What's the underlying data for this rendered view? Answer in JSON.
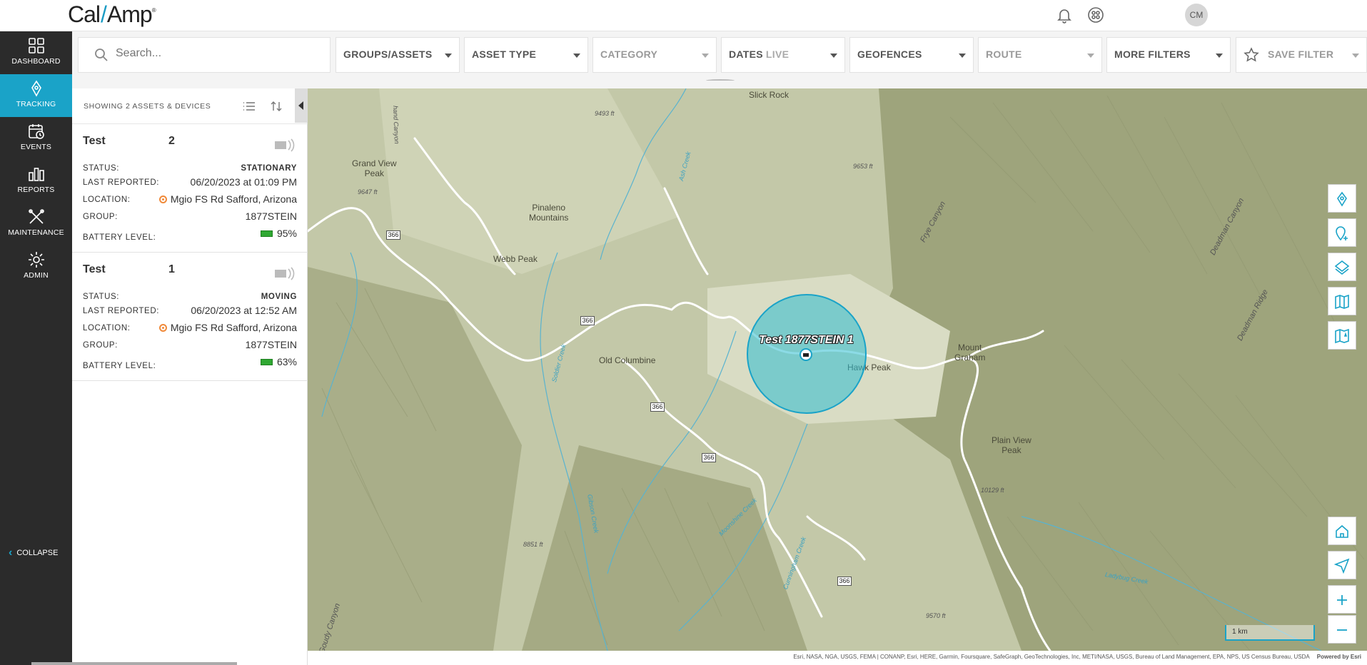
{
  "app": {
    "logo_left": "Cal",
    "logo_right": "Amp",
    "avatar_initials": "CM"
  },
  "nav": {
    "items": [
      {
        "label": "DASHBOARD",
        "icon": "dashboard-icon"
      },
      {
        "label": "TRACKING",
        "icon": "location-pin-icon",
        "active": true
      },
      {
        "label": "EVENTS",
        "icon": "calendar-clock-icon"
      },
      {
        "label": "REPORTS",
        "icon": "bar-chart-icon"
      },
      {
        "label": "MAINTENANCE",
        "icon": "tools-icon"
      },
      {
        "label": "ADMIN",
        "icon": "gear-icon"
      }
    ],
    "collapse_label": "COLLAPSE"
  },
  "filters": {
    "search_placeholder": "Search...",
    "groups_assets": "GROUPS/ASSETS",
    "asset_type": "ASSET TYPE",
    "category": "CATEGORY",
    "dates": "DATES",
    "dates_live": "LIVE",
    "geofences": "GEOFENCES",
    "route": "ROUTE",
    "more_filters": "MORE FILTERS",
    "save_filter": "SAVE FILTER"
  },
  "list": {
    "showing": "SHOWING 2 ASSETS & DEVICES",
    "labels": {
      "status": "STATUS:",
      "last_reported": "LAST REPORTED:",
      "location": "LOCATION:",
      "group": "GROUP:",
      "battery": "BATTERY LEVEL:"
    },
    "items": [
      {
        "name": "Test",
        "number": "2",
        "status": "STATIONARY",
        "last_reported": "06/20/2023 at 01:09 PM",
        "location": "Mgio FS Rd Safford, Arizona",
        "group": "1877STEIN",
        "battery": "95%"
      },
      {
        "name": "Test",
        "number": "1",
        "status": "MOVING",
        "last_reported": "06/20/2023 at 12:52 AM",
        "location": "Mgio FS Rd Safford, Arizona",
        "group": "1877STEIN",
        "battery": "63%"
      }
    ]
  },
  "map": {
    "geofence_label": "Test 1877STEIN 1",
    "places": {
      "slick_rock": "Slick Rock",
      "hand_canyon": "hand Canyon",
      "grand_view_peak": "Grand View\nPeak",
      "pinaleno": "Pinaleno\nMountains",
      "webb_peak": "Webb Peak",
      "old_columbine": "Old Columbine",
      "hawk_peak": "Hawk Peak",
      "mount_graham": "Mount\nGraham",
      "plain_view_peak": "Plain View\nPeak",
      "frye_canyon": "Frye Canyon",
      "deadman_canyon": "Deadman Canyon",
      "deadman_ridge": "Deadman Ridge",
      "goudy_canyon": "Goudy Canyon"
    },
    "elevations": [
      "9493 ft",
      "9653 ft",
      "9647 ft",
      "10129 ft",
      "8851 ft",
      "9570 ft"
    ],
    "creeks": [
      "Ash Creek",
      "Soldier Creek",
      "Moonshine Creek",
      "Cunningham Creek",
      "Ladybug Creek",
      "Gibson Creek"
    ],
    "route_shield": "366",
    "scale_label": "1 km",
    "attribution": "Esri, NASA, NGA, USGS, FEMA | CONANP, Esri, HERE, Garmin, Foursquare, SafeGraph, GeoTechnologies, Inc, METI/NASA, USGS, Bureau of Land Management, EPA, NPS, US Census Bureau, USDA",
    "powered_by": "Powered by Esri"
  },
  "colors": {
    "accent": "#1aa3c8",
    "nav_bg": "#2b2b2b",
    "battery": "#2fa832",
    "location_pin": "#f08a3a"
  }
}
